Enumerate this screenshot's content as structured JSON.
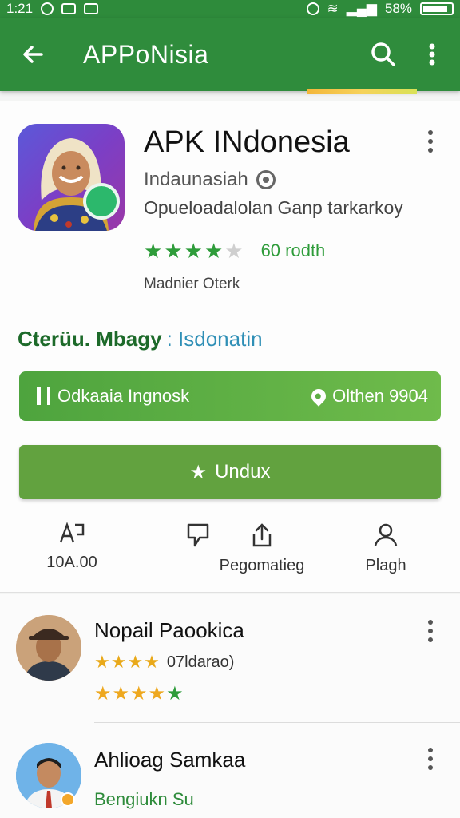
{
  "status_bar": {
    "time": "1:21",
    "battery": "58%"
  },
  "app_bar": {
    "title": "APPoNisia"
  },
  "app": {
    "title": "APK INdonesia",
    "developer": "Indaunasiah",
    "description": "Opueloadalolan Ganp tarkarkoy",
    "rating": 4,
    "rating_text": "60 rodth",
    "meta": "Madnier Oterk"
  },
  "category": {
    "label": "Cterüu. Mbagy",
    "value": ": Isdonatin"
  },
  "info_button": {
    "left": "Odkaaia Ingnosk",
    "right": "Olthen 9904"
  },
  "download_button": {
    "label": "Undux"
  },
  "actions": [
    {
      "label": "10A.00"
    },
    {
      "label": ""
    },
    {
      "label": "Pegomatieg"
    },
    {
      "label": "Plagh"
    }
  ],
  "reviews": [
    {
      "name": "Nopail Paookica",
      "subtitle": "07ldarao)",
      "rating": 4
    },
    {
      "name": "Ahlioag Samkaa",
      "subtitle": "Bengiukn Su"
    }
  ],
  "colors": {
    "primary": "#2f8c3c",
    "button": "#62a23f",
    "link": "#2f8fb6"
  }
}
